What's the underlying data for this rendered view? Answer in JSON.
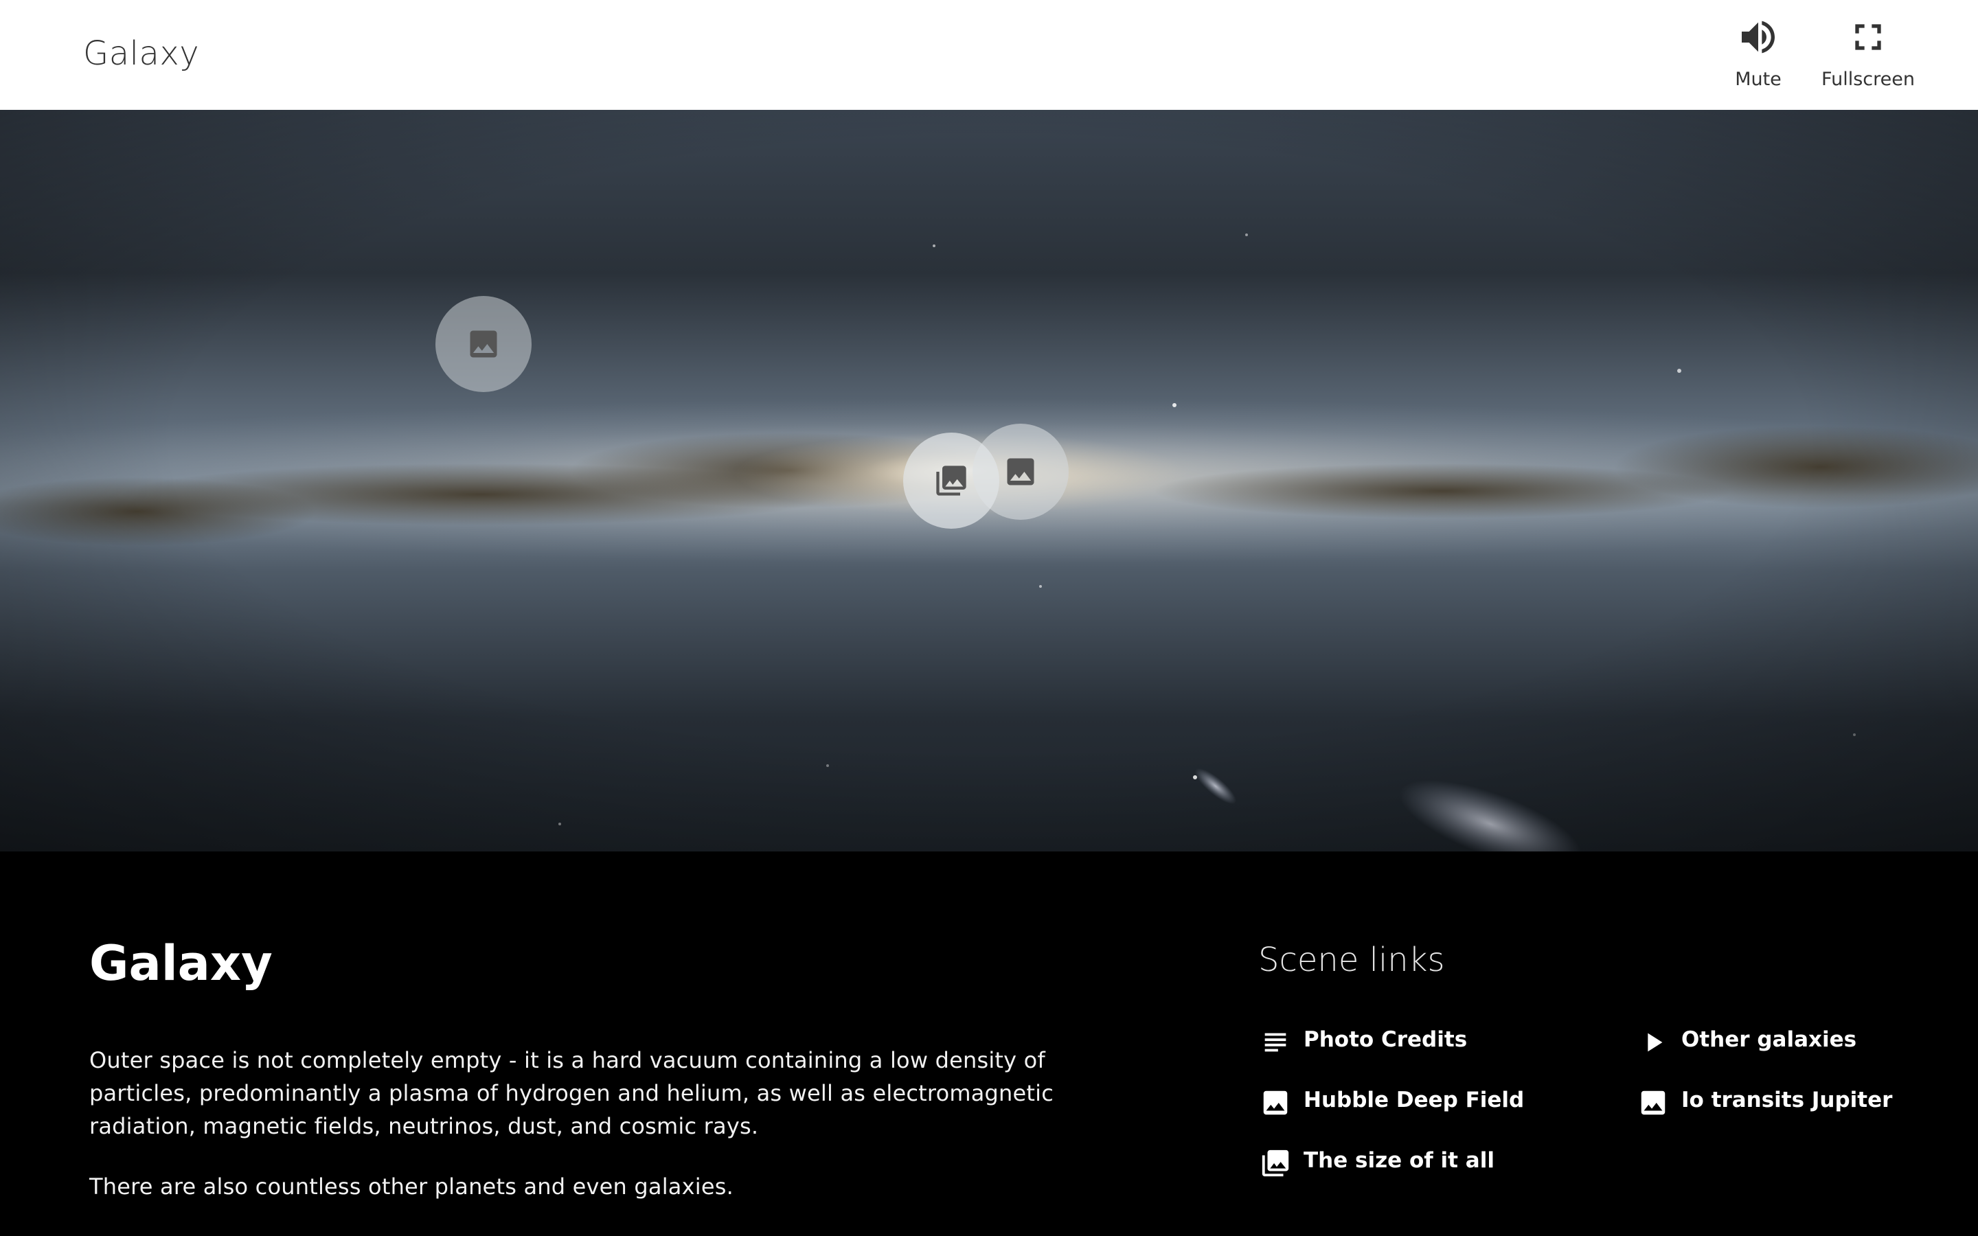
{
  "header": {
    "title": "Galaxy",
    "mute": {
      "label": "Mute",
      "icon": "volume-up-icon"
    },
    "fullscreen": {
      "label": "Fullscreen",
      "icon": "fullscreen-icon"
    }
  },
  "panorama": {
    "hotspots": [
      {
        "icon": "image-icon"
      },
      {
        "icon": "photo-library-icon"
      },
      {
        "icon": "image-icon"
      }
    ]
  },
  "scene": {
    "title": "Galaxy",
    "description": [
      "Outer space is not completely empty - it is a hard vacuum containing a low density of particles, predominantly a plasma of hydrogen and helium, as well as electromagnetic radiation, magnetic fields, neutrinos, dust, and cosmic rays.",
      "There are also countless other planets and even galaxies."
    ]
  },
  "scene_links": {
    "heading": "Scene links",
    "items": [
      {
        "label": "Photo Credits",
        "icon": "notes-icon"
      },
      {
        "label": "Hubble Deep Field",
        "icon": "image-icon"
      },
      {
        "label": "The size of it all",
        "icon": "photo-library-icon"
      },
      {
        "label": "Other galaxies",
        "icon": "play-icon"
      },
      {
        "label": "Io transits Jupiter",
        "icon": "image-icon"
      }
    ]
  },
  "colors": {
    "header_background": "#ffffff",
    "header_text": "#333333",
    "content_background": "#000000",
    "content_text": "#ffffff"
  }
}
